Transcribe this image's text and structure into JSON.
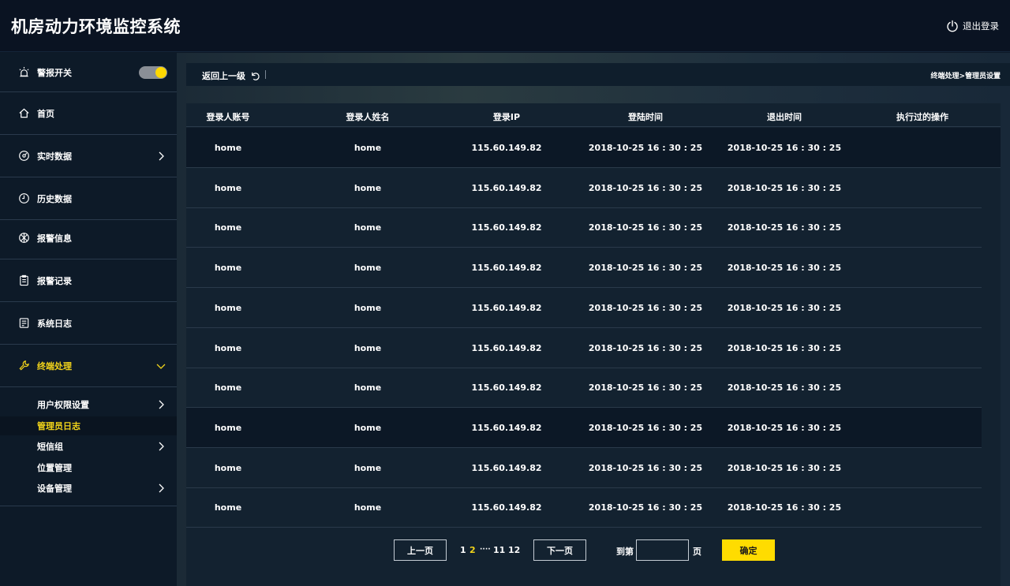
{
  "app": {
    "title": "机房动力环境监控系统",
    "logout_label": "退出登录"
  },
  "sidebar": {
    "alarm_switch": {
      "label": "警报开关",
      "on": true
    },
    "items": [
      {
        "label": "首页"
      },
      {
        "label": "实时数据"
      },
      {
        "label": "历史数据"
      },
      {
        "label": "报警信息"
      },
      {
        "label": "报警记录"
      },
      {
        "label": "系统日志"
      },
      {
        "label": "终端处理"
      }
    ],
    "subitems": [
      {
        "label": "用户权限设置"
      },
      {
        "label": "管理员日志"
      },
      {
        "label": "短信组"
      },
      {
        "label": "位置管理"
      },
      {
        "label": "设备管理"
      }
    ]
  },
  "topbar": {
    "back_label": "返回上一级",
    "breadcrumb": "终端处理>管理员设置"
  },
  "table": {
    "headers": [
      "登录人账号",
      "登录人姓名",
      "登录IP",
      "登陆时间",
      "退出时间",
      "执行过的操作"
    ],
    "rows": [
      [
        "home",
        "home",
        "115.60.149.82",
        "2018-10-25 16 : 30 : 25",
        "2018-10-25 16 : 30 : 25",
        ""
      ],
      [
        "home",
        "home",
        "115.60.149.82",
        "2018-10-25 16 : 30 : 25",
        "2018-10-25 16 : 30 : 25",
        ""
      ],
      [
        "home",
        "home",
        "115.60.149.82",
        "2018-10-25 16 : 30 : 25",
        "2018-10-25 16 : 30 : 25",
        ""
      ],
      [
        "home",
        "home",
        "115.60.149.82",
        "2018-10-25 16 : 30 : 25",
        "2018-10-25 16 : 30 : 25",
        ""
      ],
      [
        "home",
        "home",
        "115.60.149.82",
        "2018-10-25 16 : 30 : 25",
        "2018-10-25 16 : 30 : 25",
        ""
      ],
      [
        "home",
        "home",
        "115.60.149.82",
        "2018-10-25 16 : 30 : 25",
        "2018-10-25 16 : 30 : 25",
        ""
      ],
      [
        "home",
        "home",
        "115.60.149.82",
        "2018-10-25 16 : 30 : 25",
        "2018-10-25 16 : 30 : 25",
        ""
      ],
      [
        "home",
        "home",
        "115.60.149.82",
        "2018-10-25 16 : 30 : 25",
        "2018-10-25 16 : 30 : 25",
        ""
      ],
      [
        "home",
        "home",
        "115.60.149.82",
        "2018-10-25 16 : 30 : 25",
        "2018-10-25 16 : 30 : 25",
        ""
      ],
      [
        "home",
        "home",
        "115.60.149.82",
        "2018-10-25 16 : 30 : 25",
        "2018-10-25 16 : 30 : 25",
        ""
      ]
    ]
  },
  "pagination": {
    "prev_label": "上一页",
    "next_label": "下一页",
    "pages": [
      "1",
      "2",
      "····",
      "11",
      "12"
    ],
    "current_page": "2",
    "goto_label": "到第",
    "page_unit": "页",
    "goto_value": "",
    "confirm_label": "确定"
  },
  "colors": {
    "accent": "#ffdc00",
    "active_text": "#f2d41a",
    "header_bg": "#0a1322",
    "sidebar_bg": "#0d1a28"
  }
}
